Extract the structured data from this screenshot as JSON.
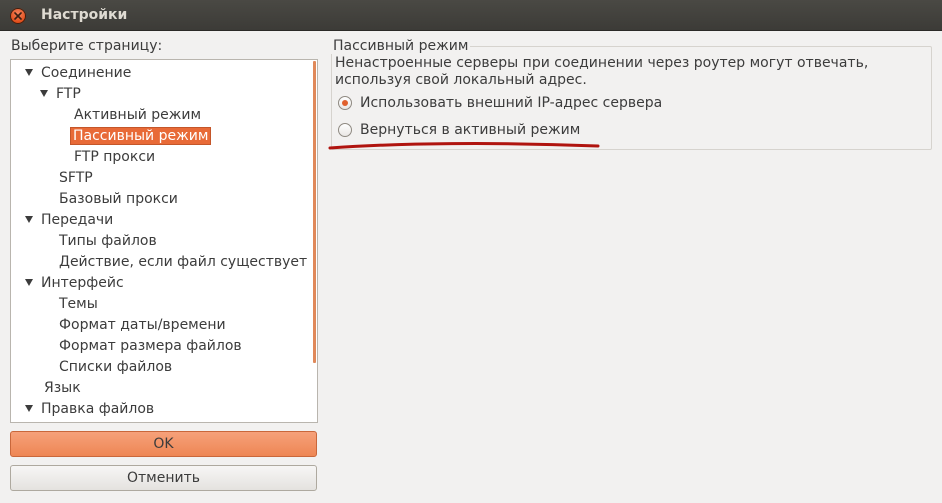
{
  "window": {
    "title": "Настройки"
  },
  "left_panel": {
    "label": "Выберите страницу:"
  },
  "tree": {
    "items": [
      {
        "label": "Соединение",
        "expanded": true
      },
      {
        "label": "FTP",
        "expanded": true
      },
      {
        "label": "Активный режим"
      },
      {
        "label": "Пассивный режим",
        "selected": true
      },
      {
        "label": "FTP прокси"
      },
      {
        "label": "SFTP"
      },
      {
        "label": "Базовый прокси"
      },
      {
        "label": "Передачи",
        "expanded": true
      },
      {
        "label": "Типы файлов"
      },
      {
        "label": "Действие, если файл существует"
      },
      {
        "label": "Интерфейс",
        "expanded": true
      },
      {
        "label": "Темы"
      },
      {
        "label": "Формат даты/времени"
      },
      {
        "label": "Формат размера файлов"
      },
      {
        "label": "Списки файлов"
      },
      {
        "label": "Язык"
      },
      {
        "label": "Правка файлов",
        "expanded": true
      }
    ]
  },
  "buttons": {
    "ok": "OK",
    "cancel": "Отменить"
  },
  "passive": {
    "group_title": "Пассивный режим",
    "description": "Ненастроенные серверы при соединении через роутер могут отвечать, используя свой локальный адрес.",
    "options": [
      {
        "label": "Использовать внешний IP-адрес сервера",
        "checked": true
      },
      {
        "label": "Вернуться в активный режим",
        "checked": false
      }
    ]
  },
  "colors": {
    "accent": "#e86a37",
    "titlebar": "#3c3b37",
    "annotation": "#b0140f"
  }
}
